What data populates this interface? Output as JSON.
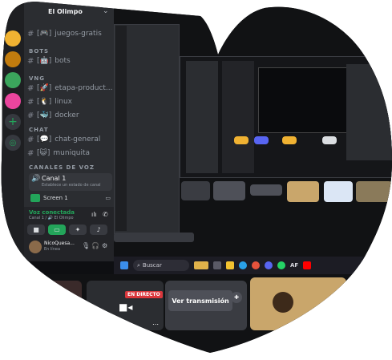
{
  "sidebar": {
    "server_title": "El Olimpo",
    "channels": [
      {
        "name": "juegos-gratis",
        "emoji": "[🎮]"
      },
      {
        "name": "bots",
        "emoji": "[🤖]"
      }
    ],
    "categories": [
      "BOTS",
      "VNG",
      "CHAT",
      "CANALES DE VOZ"
    ],
    "channels_vng": [
      {
        "name": "etapa-product...",
        "emoji": "[🚀]"
      },
      {
        "name": "linux",
        "emoji": "[🐧]"
      },
      {
        "name": "docker",
        "emoji": "[🐳]"
      }
    ],
    "channels_chat": [
      {
        "name": "chat-general",
        "emoji": "[💬]"
      },
      {
        "name": "muniquita",
        "emoji": "[😺]"
      }
    ],
    "voice_channel": {
      "name": "Canal 1",
      "status_placeholder": "Establece un estado de canal"
    },
    "screen_item": "Screen 1",
    "voice_status": {
      "title": "Voz conectada",
      "subtitle": "Canal 1 / 🔊 El Olimpo"
    },
    "user": {
      "name": "NicoQuesa...",
      "status": "En línea"
    }
  },
  "taskbar": {
    "search_placeholder": "Buscar",
    "af_label": "AF"
  },
  "bottom": {
    "live_badge": "EN DIRECTO",
    "watch_button": "Ver transmisión"
  },
  "colors": {
    "accent": "#5865f2",
    "green": "#23a55a",
    "red": "#da373c"
  }
}
